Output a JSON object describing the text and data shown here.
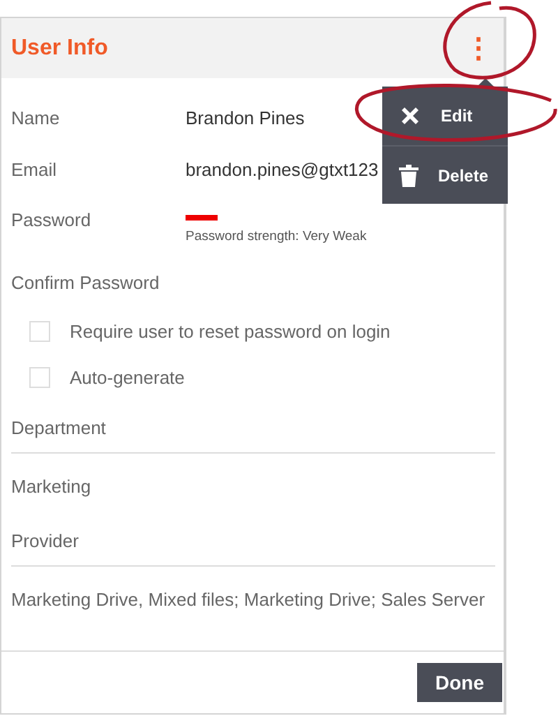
{
  "header": {
    "title": "User Info",
    "menu_icon": "⋮"
  },
  "menu": {
    "items": [
      {
        "label": "Edit",
        "kind": "edit"
      },
      {
        "label": "Delete",
        "kind": "delete"
      }
    ]
  },
  "fields": [
    {
      "label": "Name",
      "value": "Brandon Pines"
    },
    {
      "label": "Email",
      "value": "brandon.pines@gtxt123"
    },
    {
      "label": "Password",
      "kind": "password",
      "strength": {
        "text": "Password strength: Very Weak"
      }
    },
    {
      "label": "Confirm Password"
    }
  ],
  "options": [
    {
      "label": "Require user to reset password on login",
      "checked": false
    },
    {
      "label": "Auto-generate",
      "checked": false
    }
  ],
  "sections": [
    {
      "label": "Department",
      "value": "Marketing"
    },
    {
      "label": "Provider",
      "value": "Marketing Drive, Mixed files; Marketing Drive; Sales Server"
    }
  ],
  "footer": {
    "button": "Done"
  }
}
